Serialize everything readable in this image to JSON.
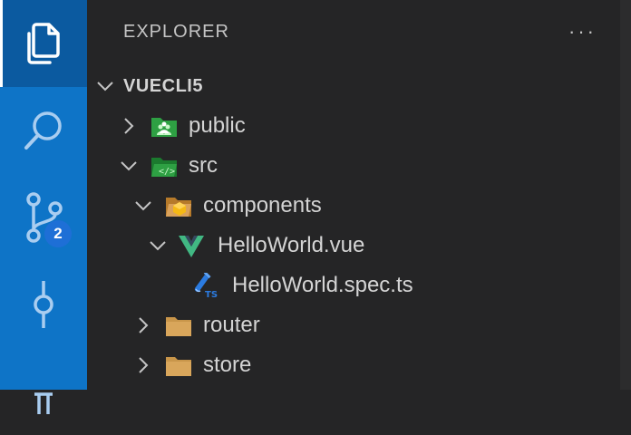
{
  "sidebar": {
    "title": "EXPLORER",
    "more_label": "···"
  },
  "activity": {
    "scm_badge": "2"
  },
  "tree": {
    "root": "VUECLI5",
    "public": "public",
    "src": "src",
    "components": "components",
    "hello_vue": "HelloWorld.vue",
    "hello_spec": "HelloWorld.spec.ts",
    "router": "router",
    "store": "store"
  },
  "colors": {
    "activity_bar": "#0e74c7",
    "activity_active": "#0b5aa0",
    "sidebar": "#252526",
    "vue_green": "#41b883",
    "folder": "#c9964a"
  }
}
